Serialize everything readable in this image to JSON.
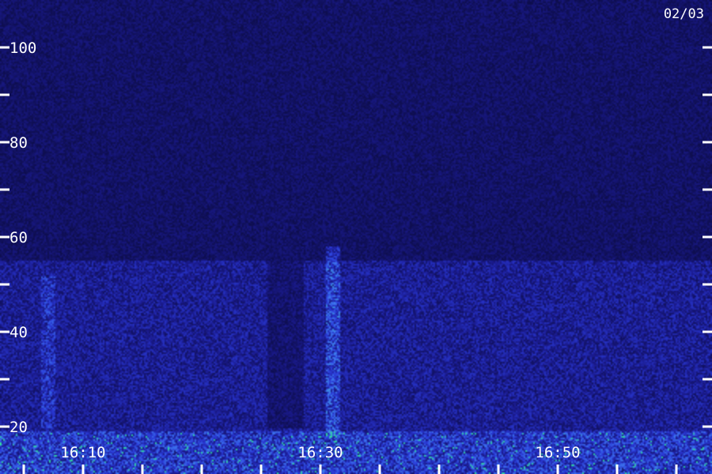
{
  "date_label": "02/03",
  "chart_data": {
    "type": "heatmap",
    "title": "",
    "xlabel": "",
    "ylabel": "",
    "x_range": [
      "16:03",
      "17:03"
    ],
    "x_tick_labels": [
      {
        "time": "16:10",
        "minutes_after_1600": 10
      },
      {
        "time": "16:30",
        "minutes_after_1600": 30
      },
      {
        "time": "16:50",
        "minutes_after_1600": 50
      }
    ],
    "x_minor_tick_interval_minutes": 5,
    "ylim": [
      10,
      110
    ],
    "y_tick_labels": [
      20,
      40,
      60,
      80,
      100
    ],
    "y_tick_interval": 10,
    "grid": false,
    "colormap": [
      "#0a0a3a",
      "#1a1a8c",
      "#2a3ad8",
      "#3f7cf0",
      "#30e0a0"
    ],
    "features": [
      {
        "name": "",
        "kind": "background_band",
        "y_from": 10,
        "y_to": 55,
        "intensity": 0.55
      },
      {
        "name": "",
        "kind": "background_band",
        "y_from": 55,
        "y_to": 110,
        "intensity": 0.2
      },
      {
        "name": "",
        "kind": "strong_band",
        "y_from": 10,
        "y_to": 19,
        "intensity": 0.9
      },
      {
        "name": "",
        "kind": "vertical_streak",
        "time_minutes_after_1600": 31,
        "y_from": 18,
        "y_to": 58,
        "intensity": 0.85
      },
      {
        "name": "",
        "kind": "vertical_streak",
        "time_minutes_after_1600": 7,
        "y_from": 20,
        "y_to": 52,
        "intensity": 0.5
      },
      {
        "name": "",
        "kind": "dark_gap",
        "time_minutes_after_1600": 27,
        "y_from": 20,
        "y_to": 55
      }
    ]
  }
}
